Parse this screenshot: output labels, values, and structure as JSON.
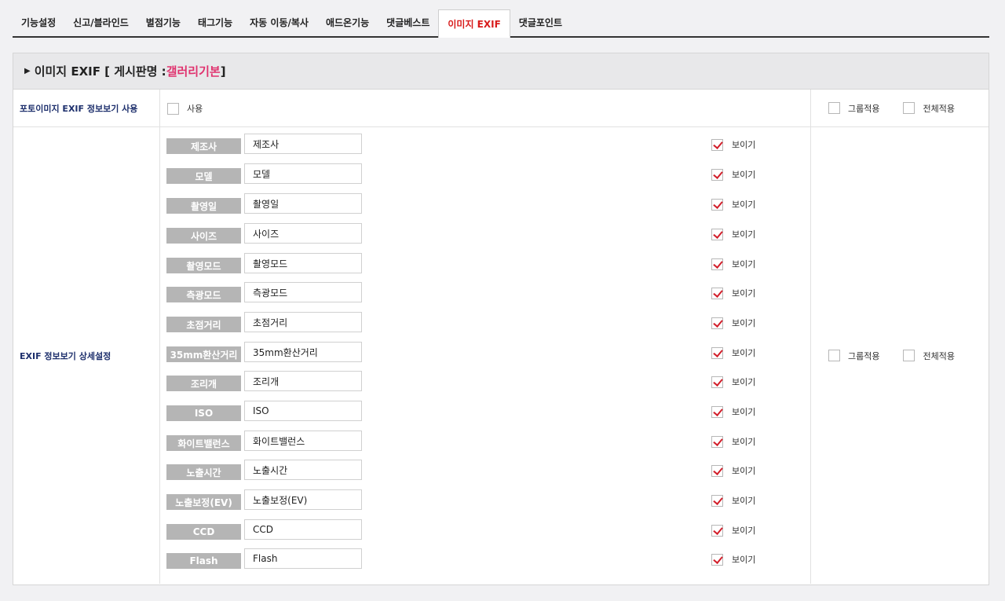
{
  "tabs": [
    {
      "label": "기능설정",
      "active": false
    },
    {
      "label": "신고/블라인드",
      "active": false
    },
    {
      "label": "별점기능",
      "active": false
    },
    {
      "label": "태그기능",
      "active": false
    },
    {
      "label": "자동 이동/복사",
      "active": false
    },
    {
      "label": "애드온기능",
      "active": false
    },
    {
      "label": "댓글베스트",
      "active": false
    },
    {
      "label": "이미지 EXIF",
      "active": true
    },
    {
      "label": "댓글포인트",
      "active": false
    }
  ],
  "panel": {
    "title_prefix": "이미지 EXIF [ 게시판명 : ",
    "board_name": "갤러리기본",
    "title_suffix": " ]"
  },
  "use_row": {
    "label": "포토이미지 EXIF 정보보기 사용",
    "use_label": "사용",
    "use_checked": false,
    "group_apply": "그룹적용",
    "all_apply": "전체적용"
  },
  "detail_row": {
    "label": "EXIF 정보보기 상세설정",
    "group_apply": "그룹적용",
    "all_apply": "전체적용",
    "show_label": "보이기",
    "fields": [
      {
        "tag": "제조사",
        "value": "제조사",
        "show": true
      },
      {
        "tag": "모델",
        "value": "모델",
        "show": true
      },
      {
        "tag": "촬영일",
        "value": "촬영일",
        "show": true
      },
      {
        "tag": "사이즈",
        "value": "사이즈",
        "show": true
      },
      {
        "tag": "촬영모드",
        "value": "촬영모드",
        "show": true
      },
      {
        "tag": "측광모드",
        "value": "측광모드",
        "show": true
      },
      {
        "tag": "초점거리",
        "value": "초점거리",
        "show": true
      },
      {
        "tag": "35mm환산거리",
        "value": "35mm환산거리",
        "show": true
      },
      {
        "tag": "조리개",
        "value": "조리개",
        "show": true
      },
      {
        "tag": "ISO",
        "value": "ISO",
        "show": true
      },
      {
        "tag": "화이트밸런스",
        "value": "화이트밸런스",
        "show": true
      },
      {
        "tag": "노출시간",
        "value": "노출시간",
        "show": true
      },
      {
        "tag": "노출보정(EV)",
        "value": "노출보정(EV)",
        "show": true
      },
      {
        "tag": "CCD",
        "value": "CCD",
        "show": true
      },
      {
        "tag": "Flash",
        "value": "Flash",
        "show": true
      }
    ]
  }
}
